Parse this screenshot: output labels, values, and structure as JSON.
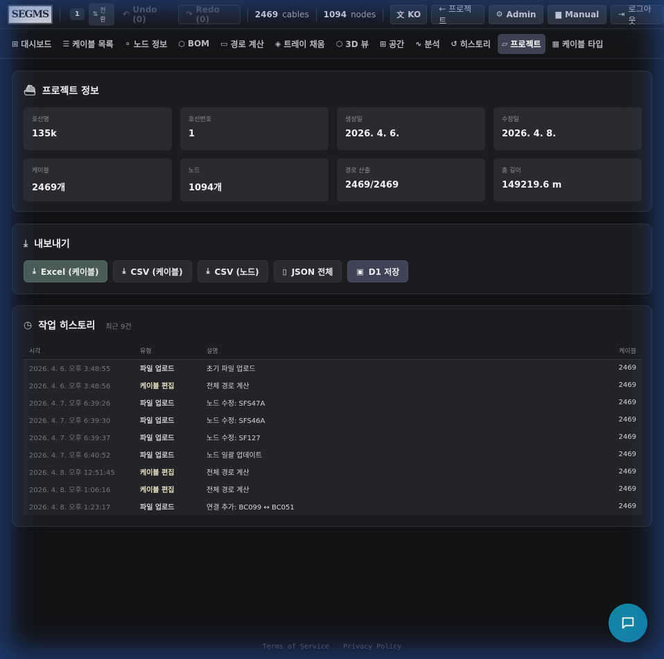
{
  "app": {
    "logo_text": "SEGMS"
  },
  "topbar": {
    "project_number": "1",
    "switch_label": "전환",
    "undo_label": "Undo (0)",
    "redo_label": "Redo (0)",
    "cables_count": "2469",
    "cables_label": "cables",
    "nodes_count": "1094",
    "nodes_label": "nodes",
    "lang_label": "KO",
    "project_label": "← 프로젝트",
    "admin_label": "Admin",
    "manual_label": "Manual",
    "logout_label": "로그아웃"
  },
  "nav": {
    "items": [
      {
        "label": "대시보드",
        "icon": "⊞"
      },
      {
        "label": "케이블 목록",
        "icon": "☰"
      },
      {
        "label": "노드 정보",
        "icon": "⚬"
      },
      {
        "label": "BOM",
        "icon": "⬡"
      },
      {
        "label": "경로 계산",
        "icon": "▭"
      },
      {
        "label": "트레이 채움",
        "icon": "◈"
      },
      {
        "label": "3D 뷰",
        "icon": "⬡"
      },
      {
        "label": "공간",
        "icon": "⊞"
      },
      {
        "label": "분석",
        "icon": "∿"
      },
      {
        "label": "히스토리",
        "icon": "↺"
      },
      {
        "label": "프로젝트",
        "icon": "▱"
      },
      {
        "label": "케이블 타입",
        "icon": "▦"
      }
    ],
    "active_index": 10
  },
  "project_info": {
    "title": "프로젝트 정보",
    "fields": [
      {
        "label": "호선명",
        "value": "135k"
      },
      {
        "label": "호선번호",
        "value": "1"
      },
      {
        "label": "생성일",
        "value": "2026. 4. 6."
      },
      {
        "label": "수정일",
        "value": "2026. 4. 8."
      },
      {
        "label": "케이블",
        "value": "2469개"
      },
      {
        "label": "노드",
        "value": "1094개"
      },
      {
        "label": "경로 산출",
        "value": "2469/2469"
      },
      {
        "label": "총 길이",
        "value": "149219.6 m"
      }
    ]
  },
  "export": {
    "title": "내보내기",
    "buttons": [
      {
        "label": "Excel (케이블)"
      },
      {
        "label": "CSV (케이블)"
      },
      {
        "label": "CSV (노드)"
      },
      {
        "label": "JSON 전체"
      },
      {
        "label": "D1 저장"
      }
    ]
  },
  "history": {
    "title": "작업 히스토리",
    "subtitle": "최근 9건",
    "columns": [
      "시각",
      "유형",
      "설명",
      "케이블"
    ],
    "rows": [
      {
        "time": "2026. 4. 6. 오후 3:48:55",
        "type": "파일 업로드",
        "desc": "초기 파일 업로드",
        "cables": "2469"
      },
      {
        "time": "2026. 4. 6. 오후 3:48:56",
        "type": "케이블 편집",
        "desc": "전체 경로 계산",
        "cables": "2469"
      },
      {
        "time": "2026. 4. 7. 오후 6:39:26",
        "type": "파일 업로드",
        "desc": "노드 수정: SFS47A",
        "cables": "2469"
      },
      {
        "time": "2026. 4. 7. 오후 6:39:30",
        "type": "파일 업로드",
        "desc": "노드 수정: SFS46A",
        "cables": "2469"
      },
      {
        "time": "2026. 4. 7. 오후 6:39:37",
        "type": "파일 업로드",
        "desc": "노드 수정: SF127",
        "cables": "2469"
      },
      {
        "time": "2026. 4. 7. 오후 6:40:52",
        "type": "파일 업로드",
        "desc": "노드 일괄 업데이트",
        "cables": "2469"
      },
      {
        "time": "2026. 4. 8. 오후 12:51:45",
        "type": "케이블 편집",
        "desc": "전체 경로 계산",
        "cables": "2469"
      },
      {
        "time": "2026. 4. 8. 오후 1:06:16",
        "type": "케이블 편집",
        "desc": "전체 경로 계산",
        "cables": "2469"
      },
      {
        "time": "2026. 4. 8. 오후 1:23:17",
        "type": "파일 업로드",
        "desc": "연결 추가: BC099 ↔ BC051",
        "cables": "2469"
      }
    ]
  },
  "footer": {
    "terms": "Terms of Service",
    "privacy": "Privacy Policy"
  },
  "colors": {
    "accent": "#1386a6",
    "active_tab": "#3d4152",
    "export_green": "#4b5c58"
  }
}
